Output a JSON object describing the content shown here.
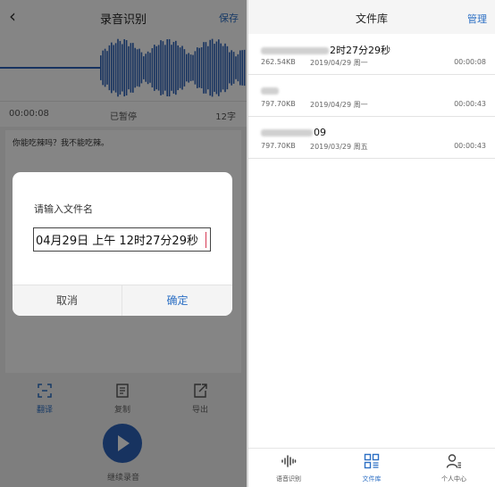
{
  "left": {
    "title": "录音识别",
    "save_label": "保存",
    "recording_time": "00:00:08",
    "status": "已暂停",
    "char_count": "12字",
    "transcript": "你能吃辣吗？我不能吃辣。",
    "actions": [
      {
        "label": "翻译",
        "icon": "translate-icon",
        "active": true
      },
      {
        "label": "复制",
        "icon": "copy-icon",
        "active": false
      },
      {
        "label": "导出",
        "icon": "export-icon",
        "active": false
      }
    ],
    "continue_label": "继续录音"
  },
  "dialog": {
    "title": "请输入文件名",
    "input_value": "04月29日 上午 12时27分29秒",
    "cancel_label": "取消",
    "ok_label": "确定"
  },
  "right": {
    "title": "文件库",
    "manage_label": "管理",
    "files": [
      {
        "name_visible": "2时27分29秒",
        "size": "262.54KB",
        "date": "2019/04/29 周一",
        "duration": "00:00:08"
      },
      {
        "name_visible": "",
        "size": "797.70KB",
        "date": "2019/04/29 周一",
        "duration": "00:00:43"
      },
      {
        "name_visible": "09",
        "size": "797.70KB",
        "date": "2019/03/29 周五",
        "duration": "00:00:43"
      }
    ],
    "tabs": [
      {
        "label": "语音识别",
        "icon": "waveform-icon",
        "active": false
      },
      {
        "label": "文件库",
        "icon": "file-library-icon",
        "active": true
      },
      {
        "label": "个人中心",
        "icon": "user-profile-icon",
        "active": false
      }
    ]
  },
  "colors": {
    "accent": "#2c6fc4",
    "wave": "#2d63b8",
    "caret": "#d63a54"
  }
}
